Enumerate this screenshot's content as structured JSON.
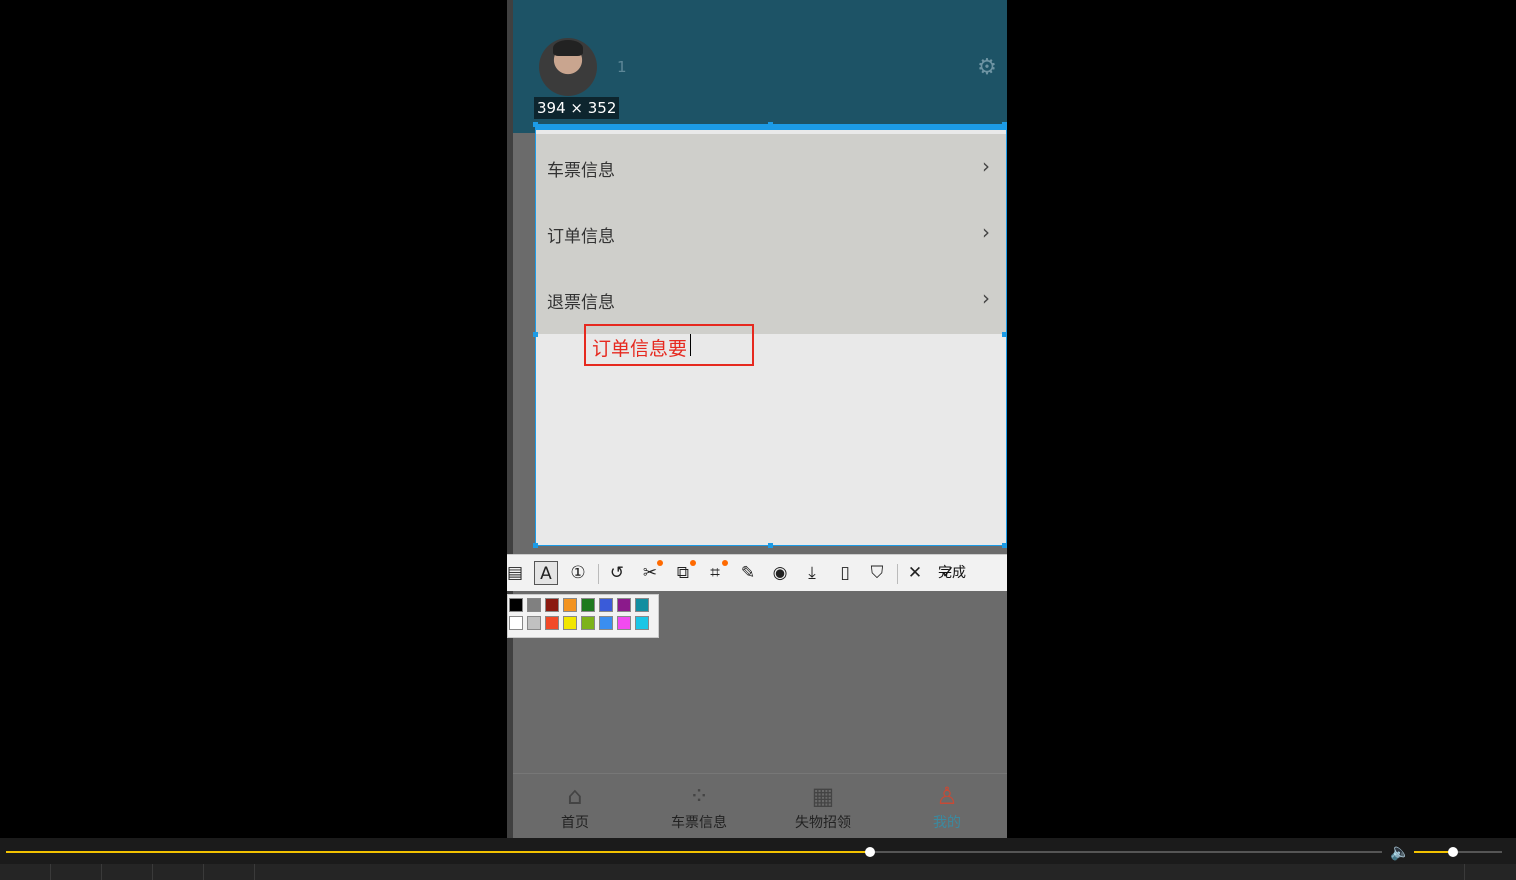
{
  "profile": {
    "username": "1",
    "settings_icon": "gear-icon"
  },
  "screenshot_tool": {
    "size_label": "394 × 352",
    "text_annotation": "订单信息要",
    "done_label": "完成",
    "tools": [
      "mosaic-icon",
      "text-tool-icon",
      "numbered-marker-icon",
      "undo-icon",
      "ocr-cut-icon",
      "translate-icon",
      "scan-icon",
      "pin-icon",
      "record-icon",
      "download-icon",
      "phone-icon",
      "bookmark-icon",
      "close-icon",
      "check-icon"
    ],
    "palette_row1": [
      "#000000",
      "#808080",
      "#8b1a10",
      "#f39421",
      "#1f7a1f",
      "#3a5bd9",
      "#8b1a8b",
      "#128ea0"
    ],
    "palette_row2": [
      "#ffffff",
      "#c0c0c0",
      "#f24a28",
      "#f2e600",
      "#7db31a",
      "#3a8ef0",
      "#f24af0",
      "#1ac6e6"
    ]
  },
  "menu": {
    "items": [
      {
        "label": "车票信息"
      },
      {
        "label": "订单信息"
      },
      {
        "label": "退票信息"
      }
    ]
  },
  "tabbar": {
    "tabs": [
      {
        "label": "首页"
      },
      {
        "label": "车票信息"
      },
      {
        "label": "失物招领"
      },
      {
        "label": "我的"
      }
    ]
  },
  "player": {
    "progress": 0.628,
    "volume": 0.44,
    "accent": "#f2c200"
  }
}
